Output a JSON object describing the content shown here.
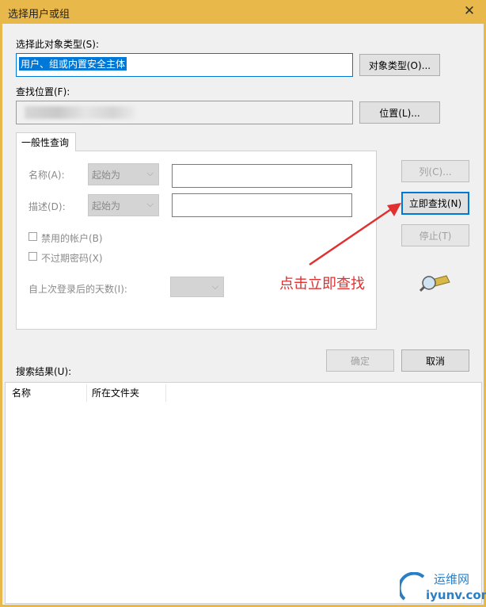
{
  "window": {
    "title": "选择用户或组",
    "close_glyph": "✕"
  },
  "object_type": {
    "label": "选择此对象类型(S):",
    "value": "用户、组或内置安全主体",
    "button": "对象类型(O)..."
  },
  "location": {
    "label": "查找位置(F):",
    "button": "位置(L)..."
  },
  "tab": {
    "label": "一般性查询"
  },
  "query": {
    "name_label": "名称(A):",
    "name_mode": "起始为",
    "desc_label": "描述(D):",
    "desc_mode": "起始为",
    "disabled_accounts": "禁用的帐户(B)",
    "non_expiring_pw": "不过期密码(X)",
    "days_label": "自上次登录后的天数(I):"
  },
  "side_buttons": {
    "columns": "列(C)...",
    "find_now": "立即查找(N)",
    "stop": "停止(T)"
  },
  "annotation": "点击立即查找",
  "dialog_buttons": {
    "ok": "确定",
    "cancel": "取消"
  },
  "results": {
    "label": "搜索结果(U):",
    "columns": [
      "名称",
      "所在文件夹"
    ]
  },
  "watermark": {
    "line1": "运维网",
    "line2": "iyunv.com"
  },
  "colors": {
    "titlebar": "#e8b84a",
    "selection": "#0078d7",
    "annotation": "#e03030"
  },
  "icons": {
    "search_icon": "flashlight-search-icon"
  }
}
